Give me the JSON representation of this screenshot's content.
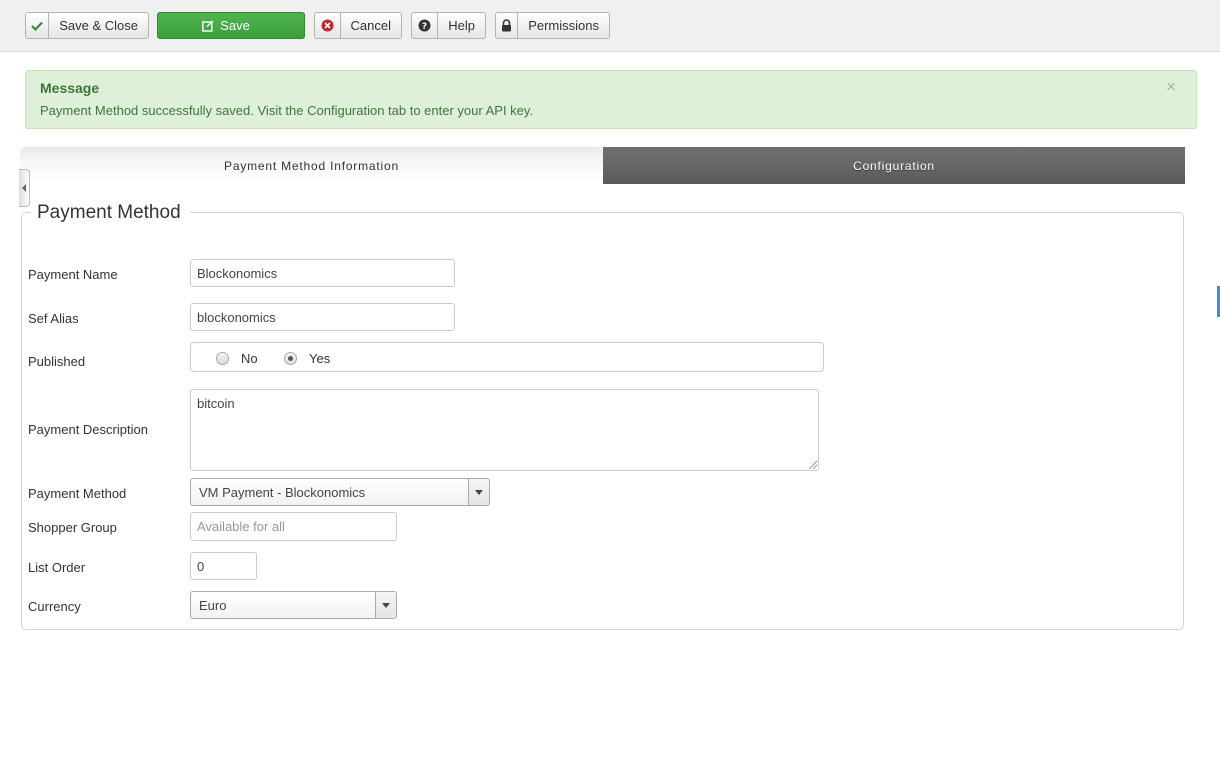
{
  "toolbar": {
    "save_close": "Save & Close",
    "save": "Save",
    "cancel": "Cancel",
    "help": "Help",
    "permissions": "Permissions"
  },
  "message": {
    "title": "Message",
    "text": "Payment Method successfully saved. Visit the Configuration tab to enter your API key.",
    "close": "×"
  },
  "tabs": [
    {
      "label": "Payment Method Information",
      "active": true
    },
    {
      "label": "Configuration",
      "active": false
    }
  ],
  "form": {
    "legend": "Payment Method",
    "payment_name": {
      "label": "Payment Name",
      "value": "Blockonomics"
    },
    "sef_alias": {
      "label": "Sef Alias",
      "value": "blockonomics"
    },
    "published": {
      "label": "Published",
      "options": [
        "No",
        "Yes"
      ],
      "selected": "Yes"
    },
    "payment_description": {
      "label": "Payment Description",
      "value": "bitcoin"
    },
    "payment_method": {
      "label": "Payment Method",
      "value": "VM Payment - Blockonomics"
    },
    "shopper_group": {
      "label": "Shopper Group",
      "placeholder": "Available for all"
    },
    "list_order": {
      "label": "List Order",
      "value": "0"
    },
    "currency": {
      "label": "Currency",
      "value": "Euro"
    }
  },
  "colors": {
    "save_green": "#43a843",
    "message_bg": "#dff0d8",
    "message_text": "#3c763d",
    "tab_inactive": "#636363"
  }
}
